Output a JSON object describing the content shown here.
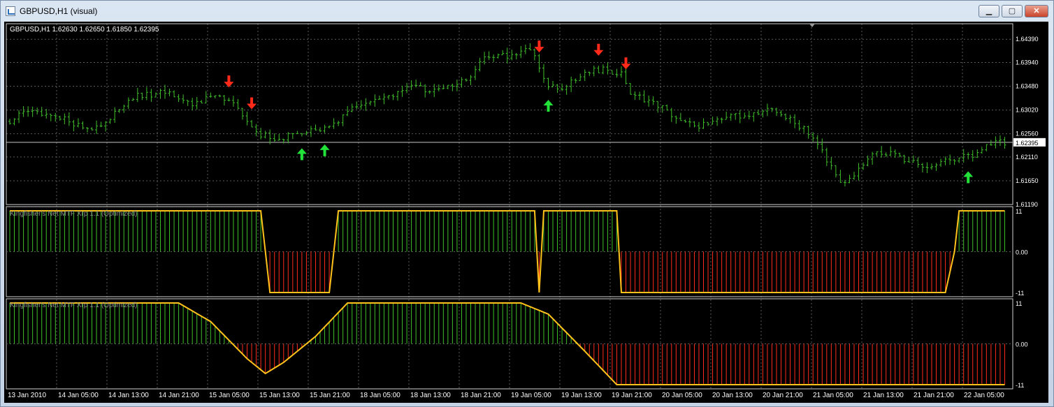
{
  "window": {
    "title": "GBPUSD,H1 (visual)",
    "min_label": "▁",
    "max_label": "▢",
    "close_label": "✕"
  },
  "main_pane": {
    "header": "GBPUSD,H1  1.62630 1.62650 1.61850 1.62395",
    "price_labels": [
      "1.64390",
      "1.63940",
      "1.63480",
      "1.63020",
      "1.62560",
      "1.62110",
      "1.61650",
      "1.61190"
    ],
    "current_price": "1.62395"
  },
  "indicator1": {
    "title": "Kingfisher's Net MTF Xrp 1.1 (Optimized)",
    "levels": [
      "11",
      "0.00",
      "-11"
    ]
  },
  "indicator2": {
    "title": "Kingfisher's Net MTF Xrp 1.1 (Optimized)",
    "levels": [
      "11",
      "0.00",
      "-11"
    ]
  },
  "time_labels": [
    "13 Jan 2010",
    "14 Jan 05:00",
    "14 Jan 13:00",
    "14 Jan 21:00",
    "15 Jan 05:00",
    "15 Jan 13:00",
    "15 Jan 21:00",
    "18 Jan 05:00",
    "18 Jan 13:00",
    "18 Jan 21:00",
    "19 Jan 05:00",
    "19 Jan 13:00",
    "19 Jan 21:00",
    "20 Jan 05:00",
    "20 Jan 13:00",
    "20 Jan 21:00",
    "21 Jan 05:00",
    "21 Jan 13:00",
    "21 Jan 21:00",
    "22 Jan 05:00"
  ],
  "chart_data": {
    "type": "candlestick",
    "symbol": "GBPUSD",
    "timeframe": "H1",
    "ohlc_last": {
      "open": 1.6263,
      "high": 1.6265,
      "low": 1.6185,
      "close": 1.62395
    },
    "ylim": [
      1.6119,
      1.6469
    ],
    "close_anchors": [
      [
        0,
        1.628
      ],
      [
        4,
        1.63
      ],
      [
        10,
        1.629
      ],
      [
        16,
        1.627
      ],
      [
        20,
        1.6265
      ],
      [
        24,
        1.6305
      ],
      [
        28,
        1.633
      ],
      [
        34,
        1.6335
      ],
      [
        40,
        1.6315
      ],
      [
        46,
        1.633
      ],
      [
        50,
        1.6305
      ],
      [
        55,
        1.6255
      ],
      [
        58,
        1.6245
      ],
      [
        66,
        1.626
      ],
      [
        70,
        1.6265
      ],
      [
        76,
        1.631
      ],
      [
        80,
        1.632
      ],
      [
        88,
        1.6345
      ],
      [
        94,
        1.634
      ],
      [
        100,
        1.636
      ],
      [
        104,
        1.64
      ],
      [
        110,
        1.641
      ],
      [
        114,
        1.642
      ],
      [
        118,
        1.635
      ],
      [
        120,
        1.634
      ],
      [
        126,
        1.6375
      ],
      [
        130,
        1.638
      ],
      [
        134,
        1.637
      ],
      [
        136,
        1.6335
      ],
      [
        140,
        1.632
      ],
      [
        146,
        1.629
      ],
      [
        150,
        1.627
      ],
      [
        156,
        1.6285
      ],
      [
        162,
        1.6295
      ],
      [
        166,
        1.6305
      ],
      [
        170,
        1.629
      ],
      [
        174,
        1.6265
      ],
      [
        178,
        1.622
      ],
      [
        182,
        1.616
      ],
      [
        186,
        1.6185
      ],
      [
        190,
        1.622
      ],
      [
        194,
        1.6215
      ],
      [
        198,
        1.62
      ],
      [
        202,
        1.619
      ],
      [
        206,
        1.6205
      ],
      [
        212,
        1.6215
      ],
      [
        216,
        1.6245
      ],
      [
        218,
        1.6239
      ]
    ],
    "down_arrows": [
      48,
      53,
      116,
      129,
      135
    ],
    "up_arrows": [
      64,
      69,
      118,
      210
    ],
    "indicator1": {
      "levels": [
        11,
        0,
        -11
      ],
      "anchors": [
        [
          0,
          11
        ],
        [
          55,
          11
        ],
        [
          57,
          -11
        ],
        [
          70,
          -11
        ],
        [
          72,
          11
        ],
        [
          115,
          11
        ],
        [
          116,
          -11
        ],
        [
          117,
          11
        ],
        [
          133,
          11
        ],
        [
          134,
          -11
        ],
        [
          205,
          -11
        ],
        [
          207,
          0
        ],
        [
          208,
          11
        ]
      ]
    },
    "indicator2": {
      "levels": [
        11,
        0,
        -11
      ],
      "anchors": [
        [
          0,
          11
        ],
        [
          37,
          11
        ],
        [
          44,
          6
        ],
        [
          52,
          -4
        ],
        [
          56,
          -8
        ],
        [
          60,
          -5
        ],
        [
          67,
          2
        ],
        [
          74,
          11
        ],
        [
          112,
          11
        ],
        [
          118,
          8
        ],
        [
          126,
          -2
        ],
        [
          133,
          -11
        ],
        [
          208,
          -11
        ]
      ]
    },
    "colors": {
      "bull": "#3fbf2a",
      "bear": "#ff2a1a",
      "line": "#ffc21a",
      "grid": "#5a5a5a",
      "text": "#ffffff"
    }
  }
}
